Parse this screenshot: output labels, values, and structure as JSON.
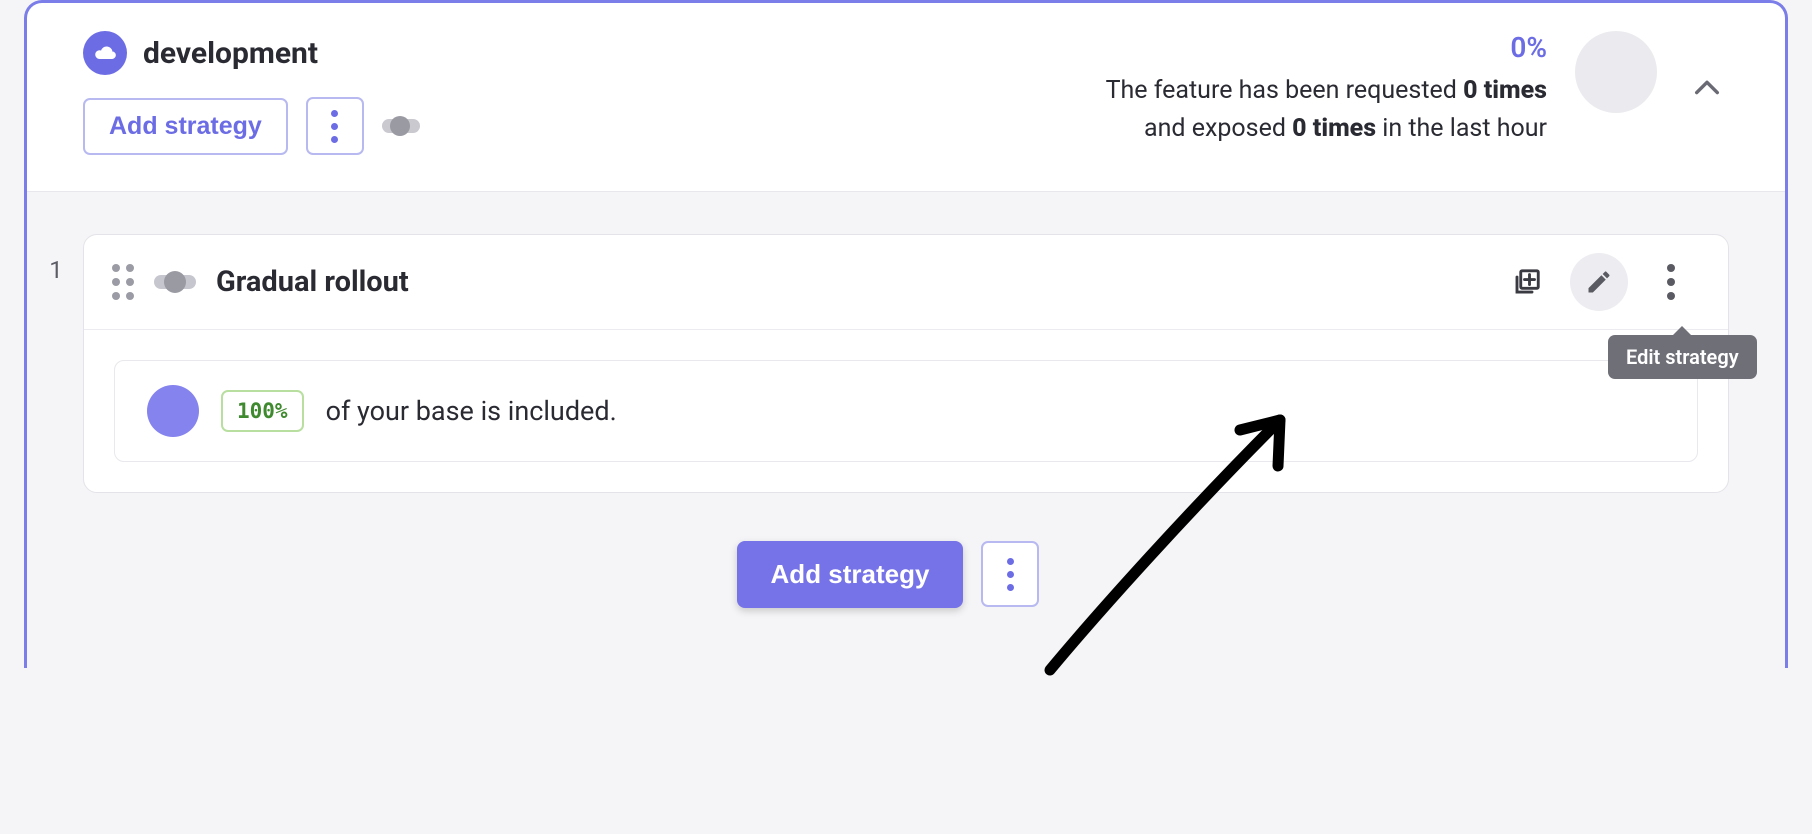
{
  "environment": {
    "name": "development",
    "stats": {
      "percentage": "0%",
      "line1_prefix": "The feature has been requested ",
      "requested_count": "0 times",
      "line2_prefix": "and exposed ",
      "exposed_count": "0 times",
      "line2_suffix": " in the last hour"
    },
    "add_strategy_label": "Add strategy"
  },
  "strategies": [
    {
      "index": "1",
      "title": "Gradual rollout",
      "rollout_percentage": "100%",
      "inclusion_text": "of your base is included."
    }
  ],
  "tooltip": {
    "edit_strategy": "Edit strategy"
  },
  "bottom": {
    "add_strategy_label": "Add strategy"
  }
}
